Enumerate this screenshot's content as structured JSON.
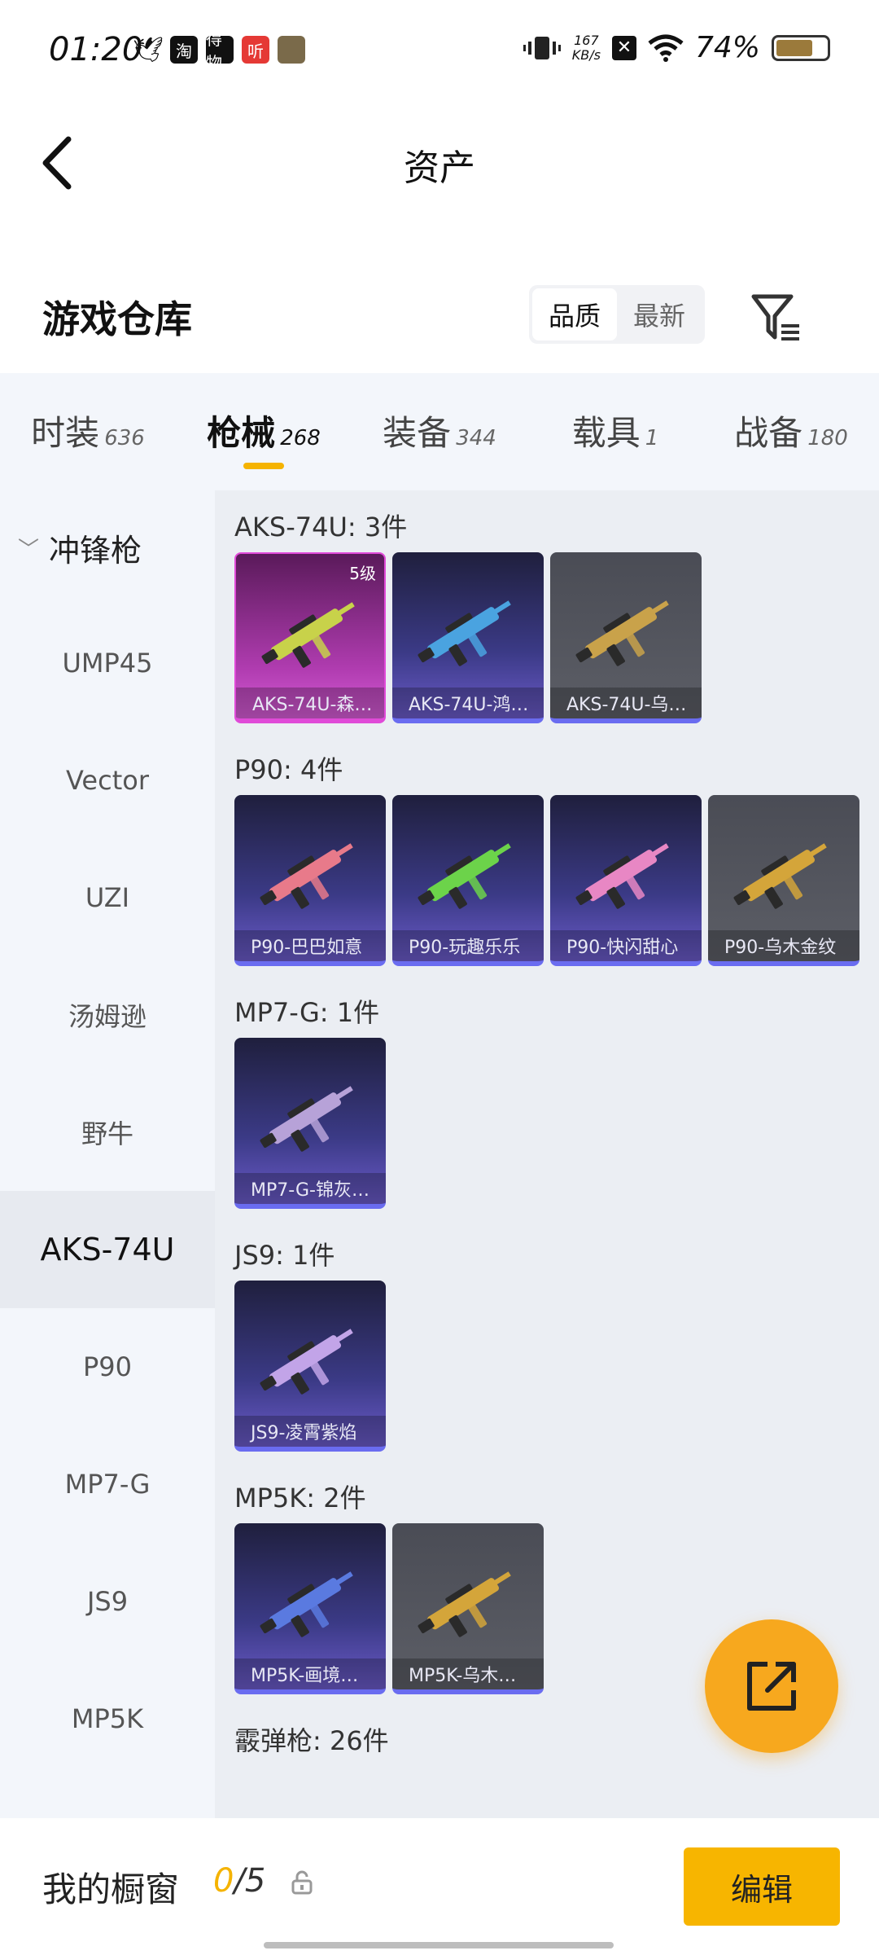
{
  "status_bar": {
    "time": "01:20",
    "net_speed_value": "167",
    "net_speed_unit": "KB/s",
    "battery": "74%",
    "battery_level": 0.74,
    "apps": [
      {
        "icon": "bird-icon",
        "text": "🕊"
      },
      {
        "icon": "taobao-icon",
        "text": "淘"
      },
      {
        "icon": "app-black-icon",
        "text": "得物"
      },
      {
        "icon": "listen-app-icon",
        "text": "听"
      },
      {
        "icon": "game-app-icon",
        "text": ""
      }
    ]
  },
  "header": {
    "title": "资产",
    "back_icon": "chevron-left-icon"
  },
  "warehouse": {
    "title": "游戏仓库",
    "sort_options": [
      "品质",
      "最新"
    ],
    "sort_active": 0,
    "filter_icon": "filter-icon"
  },
  "tabs": [
    {
      "label": "时装",
      "count": "636"
    },
    {
      "label": "枪械",
      "count": "268",
      "active": true
    },
    {
      "label": "装备",
      "count": "344"
    },
    {
      "label": "载具",
      "count": "1"
    },
    {
      "label": "战备",
      "count": "180"
    }
  ],
  "sidebar": {
    "group": "冲锋枪",
    "items": [
      "UMP45",
      "Vector",
      "UZI",
      "汤姆逊",
      "野牛",
      "AKS-74U",
      "P90",
      "MP7-G",
      "JS9",
      "MP5K"
    ],
    "active": "AKS-74U"
  },
  "groups": [
    {
      "title": "AKS-74U: 3件",
      "cards": [
        {
          "label": "AKS-74U-森…",
          "style": "pink",
          "badge": "5级",
          "accent": "#c8d24a"
        },
        {
          "label": "AKS-74U-鸿…",
          "style": "purple",
          "accent": "#4aa3e0"
        },
        {
          "label": "AKS-74U-乌…",
          "style": "gray",
          "accent": "#c9a24a"
        }
      ]
    },
    {
      "title": "P90: 4件",
      "cards": [
        {
          "label": "P90-巴巴如意",
          "style": "purple",
          "accent": "#e87a8a"
        },
        {
          "label": "P90-玩趣乐乐",
          "style": "purple",
          "accent": "#6cd34a"
        },
        {
          "label": "P90-快闪甜心",
          "style": "purple",
          "accent": "#e887c4"
        },
        {
          "label": "P90-乌木金纹",
          "style": "gray",
          "accent": "#d4a53a"
        }
      ]
    },
    {
      "title": "MP7-G: 1件",
      "cards": [
        {
          "label": "MP7-G-锦灰…",
          "style": "purple",
          "accent": "#b7a2d8"
        }
      ]
    },
    {
      "title": "JS9: 1件",
      "cards": [
        {
          "label": "JS9-凌霄紫焰",
          "style": "purple",
          "accent": "#c2a4e8"
        }
      ]
    },
    {
      "title": "MP5K: 2件",
      "cards": [
        {
          "label": "MP5K-画境…",
          "style": "purple",
          "accent": "#5a7ae0"
        },
        {
          "label": "MP5K-乌木…",
          "style": "gray",
          "accent": "#d4a53a"
        }
      ]
    },
    {
      "title": "霰弹枪: 26件",
      "cards": []
    }
  ],
  "fab": {
    "icon": "share-external-icon"
  },
  "bottom_bar": {
    "label": "我的橱窗",
    "count_current": "0",
    "count_total": "/5",
    "lock_icon": "lock-icon",
    "edit_label": "编辑"
  }
}
